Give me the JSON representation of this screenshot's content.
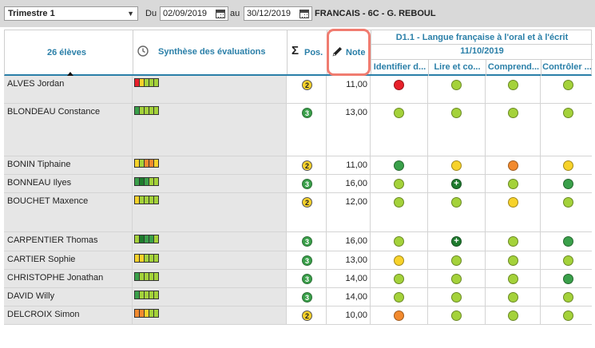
{
  "toolbar": {
    "period_select": "Trimestre 1",
    "from_label": "Du",
    "from_date": "02/09/2019",
    "to_label": "au",
    "to_date": "30/12/2019",
    "class_title": "FRANCAIS - 6C - G. REBOUL"
  },
  "header": {
    "students_count": "26 élèves",
    "synthesis_label": "Synthèse des évaluations",
    "position_label": "Pos.",
    "note_label": "Note",
    "domain_label": "D1.1 - Langue française à l'oral et à l'écrit",
    "date_label": "11/10/2019",
    "skills": [
      "Identifier d...",
      "Lire et co...",
      "Comprend...",
      "Contrôler ..."
    ]
  },
  "colors": {
    "red": "#e8202a",
    "orange": "#f28a2e",
    "yellow": "#f7d22a",
    "lightgreen": "#a4d23a",
    "green": "#3aa04a",
    "darkgreen": "#1e7b2e",
    "accent": "#2a7fa8"
  },
  "students": [
    {
      "name": "ALVES Jordan",
      "synth": [
        "red",
        "yellow",
        "lightgreen",
        "lightgreen",
        "lightgreen"
      ],
      "pos": "2",
      "note": "11,00",
      "skills": [
        "red",
        "lightgreen",
        "lightgreen",
        "lightgreen"
      ]
    },
    {
      "name": "BLONDEAU Constance",
      "synth": [
        "green",
        "lightgreen",
        "lightgreen",
        "lightgreen",
        "lightgreen"
      ],
      "pos": "3",
      "note": "13,00",
      "skills": [
        "lightgreen",
        "lightgreen",
        "lightgreen",
        "lightgreen"
      ]
    },
    {
      "name": "BONIN Tiphaine",
      "synth": [
        "yellow",
        "lightgreen",
        "orange",
        "orange",
        "yellow"
      ],
      "pos": "2",
      "note": "11,00",
      "skills": [
        "green",
        "yellow",
        "orange",
        "yellow"
      ]
    },
    {
      "name": "BONNEAU Ilyes",
      "synth": [
        "green",
        "darkgreen",
        "green",
        "lightgreen",
        "lightgreen"
      ],
      "pos": "3",
      "note": "16,00",
      "skills": [
        "lightgreen",
        "darkgreen-plus",
        "lightgreen",
        "green"
      ]
    },
    {
      "name": "BOUCHET Maxence",
      "synth": [
        "yellow",
        "lightgreen",
        "lightgreen",
        "lightgreen",
        "lightgreen"
      ],
      "pos": "2",
      "note": "12,00",
      "skills": [
        "lightgreen",
        "lightgreen",
        "yellow",
        "lightgreen"
      ]
    },
    {
      "name": "CARPENTIER Thomas",
      "synth": [
        "lightgreen",
        "darkgreen",
        "green",
        "green",
        "lightgreen"
      ],
      "pos": "3",
      "note": "16,00",
      "skills": [
        "lightgreen",
        "darkgreen-plus",
        "lightgreen",
        "green"
      ]
    },
    {
      "name": "CARTIER Sophie",
      "synth": [
        "yellow",
        "yellow",
        "lightgreen",
        "lightgreen",
        "lightgreen"
      ],
      "pos": "3",
      "note": "13,00",
      "skills": [
        "yellow",
        "lightgreen",
        "lightgreen",
        "lightgreen"
      ]
    },
    {
      "name": "CHRISTOPHE Jonathan",
      "synth": [
        "green",
        "lightgreen",
        "lightgreen",
        "lightgreen",
        "lightgreen"
      ],
      "pos": "3",
      "note": "14,00",
      "skills": [
        "lightgreen",
        "lightgreen",
        "lightgreen",
        "green"
      ]
    },
    {
      "name": "DAVID Willy",
      "synth": [
        "green",
        "lightgreen",
        "lightgreen",
        "lightgreen",
        "lightgreen"
      ],
      "pos": "3",
      "note": "14,00",
      "skills": [
        "lightgreen",
        "lightgreen",
        "lightgreen",
        "lightgreen"
      ]
    },
    {
      "name": "DELCROIX Simon",
      "synth": [
        "orange",
        "orange",
        "yellow",
        "lightgreen",
        "lightgreen"
      ],
      "pos": "2",
      "note": "10,00",
      "skills": [
        "orange",
        "lightgreen",
        "lightgreen",
        "lightgreen"
      ]
    }
  ]
}
